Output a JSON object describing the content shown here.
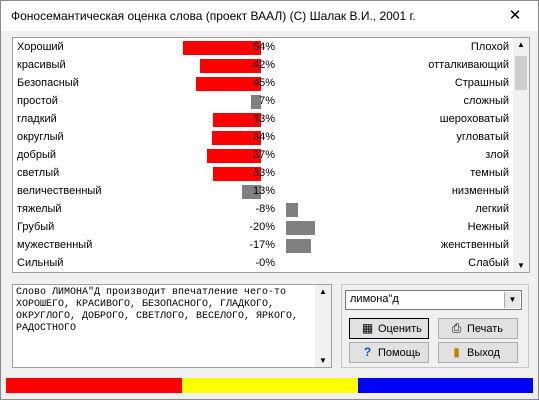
{
  "window": {
    "title": "Фоносемантическая оценка слова  (проект ВААЛ)  (С) Шалак В.И., 2001 г.",
    "close_glyph": "✕"
  },
  "scales": [
    {
      "left": "Хороший",
      "right": "Плохой",
      "value": 54,
      "label": "54%",
      "color": "#ff0000"
    },
    {
      "left": "красивый",
      "right": "отталкивающий",
      "value": 42,
      "label": "42%",
      "color": "#ff0000"
    },
    {
      "left": "Безопасный",
      "right": "Страшный",
      "value": 45,
      "label": "45%",
      "color": "#ff0000"
    },
    {
      "left": "простой",
      "right": "сложный",
      "value": 7,
      "label": "7%",
      "color": "#808080"
    },
    {
      "left": "гладкий",
      "right": "шероховатый",
      "value": 33,
      "label": "33%",
      "color": "#ff0000"
    },
    {
      "left": "округлый",
      "right": "угловатый",
      "value": 34,
      "label": "34%",
      "color": "#ff0000"
    },
    {
      "left": "добрый",
      "right": "злой",
      "value": 37,
      "label": "37%",
      "color": "#ff0000"
    },
    {
      "left": "светлый",
      "right": "темный",
      "value": 33,
      "label": "33%",
      "color": "#ff0000"
    },
    {
      "left": "величественный",
      "right": "низменный",
      "value": 13,
      "label": "13%",
      "color": "#808080"
    },
    {
      "left": "тяжелый",
      "right": "легкий",
      "value": -8,
      "label": "-8%",
      "color": "#808080"
    },
    {
      "left": "Грубый",
      "right": "Нежный",
      "value": -20,
      "label": "-20%",
      "color": "#808080"
    },
    {
      "left": "мужественный",
      "right": "женственный",
      "value": -17,
      "label": "-17%",
      "color": "#808080"
    },
    {
      "left": "Сильный",
      "right": "Слабый",
      "value": 0,
      "label": "-0%",
      "color": "#808080"
    }
  ],
  "description": "Слово ЛИМОНА\"Д производит впечатление чего-то ХОРОШЕГО, КРАСИВОГО, БЕЗОПАСНОГО, ГЛАДКОГО, ОКРУГЛОГО, ДОБРОГО, СВЕТЛОГО, ВЕСЕЛОГО, ЯРКОГО, РАДОСТНОГО",
  "controls": {
    "word": "лимона\"д",
    "evaluate_label": "Оценить",
    "print_label": "Печать",
    "help_label": "Помощь",
    "exit_label": "Выход"
  },
  "colors": {
    "red": "#ff0000",
    "yellow": "#ffff00",
    "blue": "#0000ff",
    "gray": "#808080"
  }
}
